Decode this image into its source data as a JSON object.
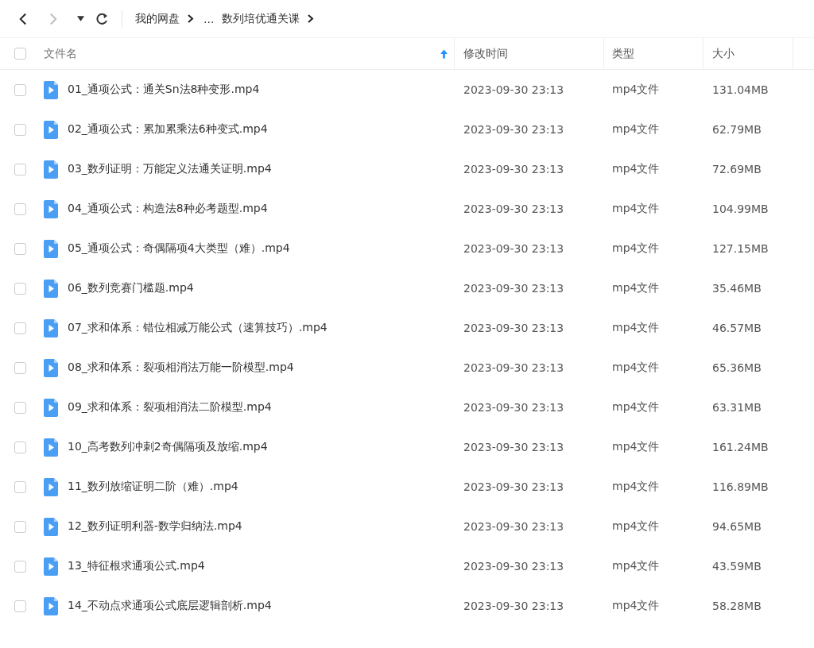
{
  "toolbar": {
    "back_enabled": true,
    "forward_enabled": false,
    "breadcrumb": [
      "我的网盘",
      "...",
      "数列培优通关课"
    ]
  },
  "table": {
    "columns": [
      {
        "label": "文件名",
        "sorted": true
      },
      {
        "label": "修改时间",
        "sorted": false
      },
      {
        "label": "类型",
        "sorted": false
      },
      {
        "label": "大小",
        "sorted": false
      }
    ],
    "all_checked": false,
    "rows": [
      {
        "name": "01_通项公式：通关Sn法8种变形.mp4",
        "modified": "2023-09-30 23:13",
        "type": "mp4文件",
        "size": "131.04MB",
        "checked": false
      },
      {
        "name": "02_通项公式：累加累乘法6种变式.mp4",
        "modified": "2023-09-30 23:13",
        "type": "mp4文件",
        "size": "62.79MB",
        "checked": false
      },
      {
        "name": "03_数列证明：万能定义法通关证明.mp4",
        "modified": "2023-09-30 23:13",
        "type": "mp4文件",
        "size": "72.69MB",
        "checked": false
      },
      {
        "name": "04_通项公式：构造法8种必考题型.mp4",
        "modified": "2023-09-30 23:13",
        "type": "mp4文件",
        "size": "104.99MB",
        "checked": false
      },
      {
        "name": "05_通项公式：奇偶隔项4大类型（难）.mp4",
        "modified": "2023-09-30 23:13",
        "type": "mp4文件",
        "size": "127.15MB",
        "checked": false
      },
      {
        "name": "06_数列竞赛门槛题.mp4",
        "modified": "2023-09-30 23:13",
        "type": "mp4文件",
        "size": "35.46MB",
        "checked": false
      },
      {
        "name": "07_求和体系：错位相减万能公式（速算技巧）.mp4",
        "modified": "2023-09-30 23:13",
        "type": "mp4文件",
        "size": "46.57MB",
        "checked": false
      },
      {
        "name": "08_求和体系：裂项相消法万能一阶模型.mp4",
        "modified": "2023-09-30 23:13",
        "type": "mp4文件",
        "size": "65.36MB",
        "checked": false
      },
      {
        "name": "09_求和体系：裂项相消法二阶模型.mp4",
        "modified": "2023-09-30 23:13",
        "type": "mp4文件",
        "size": "63.31MB",
        "checked": false
      },
      {
        "name": "10_高考数列冲刺2奇偶隔项及放缩.mp4",
        "modified": "2023-09-30 23:13",
        "type": "mp4文件",
        "size": "161.24MB",
        "checked": false
      },
      {
        "name": "11_数列放缩证明二阶（难）.mp4",
        "modified": "2023-09-30 23:13",
        "type": "mp4文件",
        "size": "116.89MB",
        "checked": false
      },
      {
        "name": "12_数列证明利器-数学归纳法.mp4",
        "modified": "2023-09-30 23:13",
        "type": "mp4文件",
        "size": "94.65MB",
        "checked": false
      },
      {
        "name": "13_特征根求通项公式.mp4",
        "modified": "2023-09-30 23:13",
        "type": "mp4文件",
        "size": "43.59MB",
        "checked": false
      },
      {
        "name": "14_不动点求通项公式底层逻辑剖析.mp4",
        "modified": "2023-09-30 23:13",
        "type": "mp4文件",
        "size": "58.28MB",
        "checked": false
      }
    ]
  }
}
